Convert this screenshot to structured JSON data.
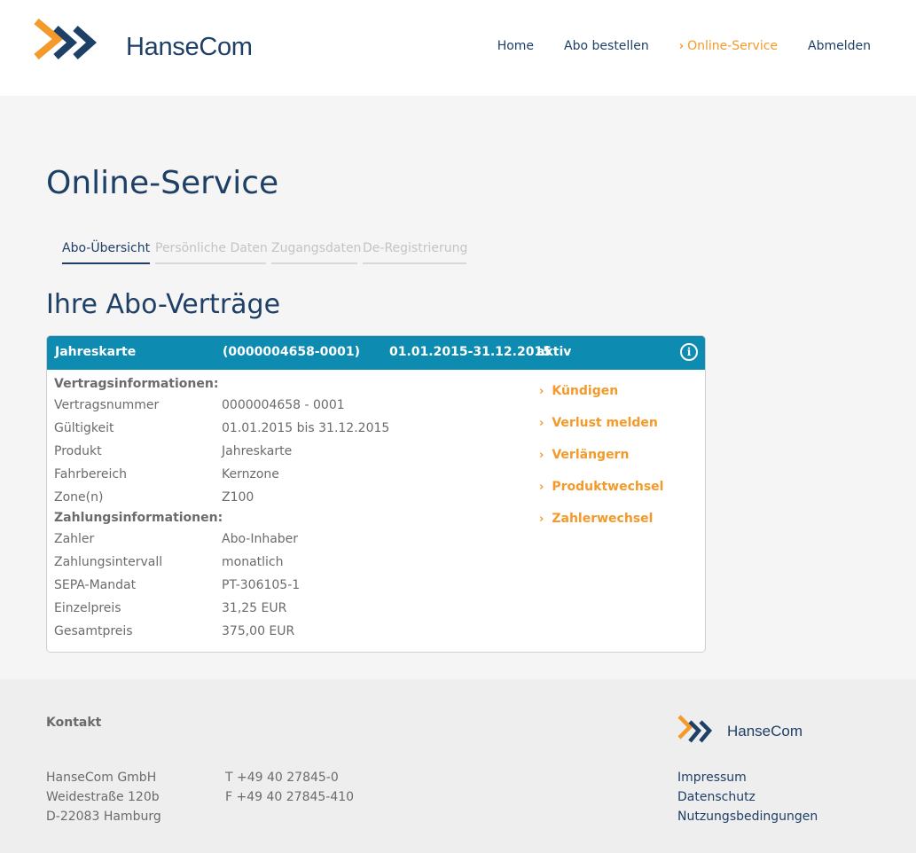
{
  "brand": {
    "name": "HanseCom",
    "accent": "#f39a2b",
    "dark": "#1e3f66",
    "header_bar": "#0d8bb0"
  },
  "nav": [
    {
      "label": "Home",
      "active": false
    },
    {
      "label": "Abo bestellen",
      "active": false
    },
    {
      "label": "Online-Service",
      "active": true
    },
    {
      "label": "Abmelden",
      "active": false
    }
  ],
  "page": {
    "title": "Online-Service",
    "section_title": "Ihre Abo-Verträge"
  },
  "tabs": [
    {
      "label": "Abo-Übersicht",
      "active": true
    },
    {
      "label": "Persönliche Daten",
      "active": false
    },
    {
      "label": "Zugangsdaten",
      "active": false
    },
    {
      "label": "De-Registrierung",
      "active": false
    }
  ],
  "contract": {
    "header": {
      "type": "Jahreskarte",
      "number": "(0000004658-0001)",
      "period": "01.01.2015-31.12.2015",
      "status": "aktiv",
      "info_icon": "info-circle-icon"
    },
    "contract_info_title": "Vertragsinformationen:",
    "contract_info": [
      {
        "label": "Vertragsnummer",
        "value": "0000004658 - 0001"
      },
      {
        "label": "Gültigkeit",
        "value": "01.01.2015 bis 31.12.2015"
      },
      {
        "label": "Produkt",
        "value": "Jahreskarte"
      },
      {
        "label": "Fahrbereich",
        "value": "Kernzone"
      },
      {
        "label": "Zone(n)",
        "value": "Z100"
      }
    ],
    "payment_info_title": "Zahlungsinformationen:",
    "payment_info": [
      {
        "label": "Zahler",
        "value": "Abo-Inhaber"
      },
      {
        "label": "Zahlungsintervall",
        "value": "monatlich"
      },
      {
        "label": "SEPA-Mandat",
        "value": "PT-306105-1"
      },
      {
        "label": "Einzelpreis",
        "value": "31,25 EUR"
      },
      {
        "label": "Gesamtpreis",
        "value": "375,00 EUR"
      }
    ],
    "actions": [
      "Kündigen",
      "Verlust melden",
      "Verlängern",
      "Produktwechsel",
      "Zahlerwechsel"
    ]
  },
  "footer": {
    "contact_title": "Kontakt",
    "address": [
      "HanseCom GmbH",
      "Weidestraße 120b",
      "D-22083 Hamburg"
    ],
    "phone": [
      "T +49 40 27845-0",
      "F +49 40 27845-410"
    ],
    "links": [
      "Impressum",
      "Datenschutz",
      "Nutzungsbedingungen"
    ]
  }
}
